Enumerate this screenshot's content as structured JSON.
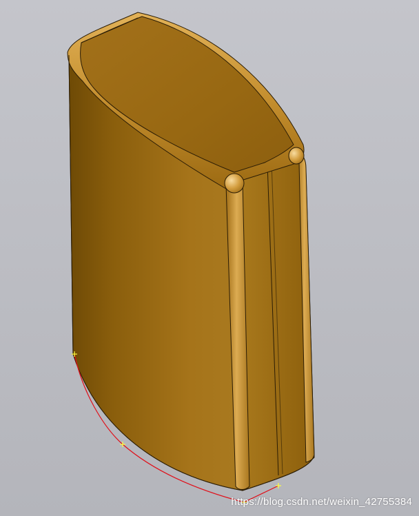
{
  "scene": {
    "background_color": "#bcbdc3",
    "model_color": "#b07d1a",
    "edge_color": "#2a1c05",
    "sketch_curve_color": "#e0101a",
    "sketch_point_color": "#ffff40"
  },
  "watermark": {
    "text": "https://blog.csdn.net/weixin_42755384"
  }
}
